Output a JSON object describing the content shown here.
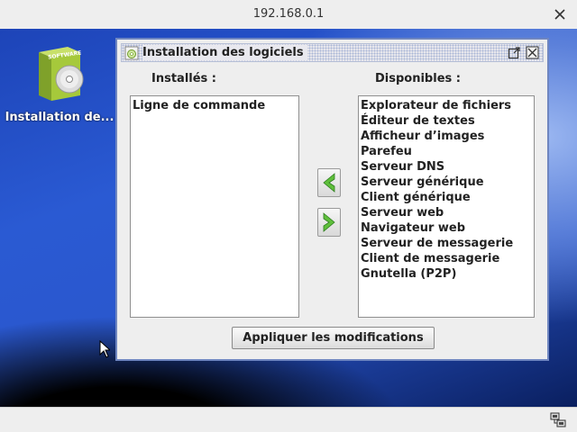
{
  "window": {
    "title": "192.168.0.1"
  },
  "desktop": {
    "icon_label": "Installation de...",
    "icon_badge": "SOFTWARE"
  },
  "app": {
    "title": "Installation des logiciels",
    "installed_header": "Installés :",
    "available_header": "Disponibles :",
    "installed": [
      "Ligne de commande"
    ],
    "available": [
      "Explorateur de fichiers",
      "Éditeur de textes",
      "Afficheur d’images",
      "Parefeu",
      "Serveur DNS",
      "Serveur générique",
      "Client générique",
      "Serveur web",
      "Navigateur web",
      "Serveur de messagerie",
      "Client de messagerie",
      "Gnutella (P2P)"
    ],
    "apply_label": "Appliquer les modifications"
  },
  "icons": {
    "close": "close-icon",
    "maximize": "maximize-icon",
    "add": "arrow-left-icon",
    "remove": "arrow-right-icon",
    "network": "network-icon"
  },
  "colors": {
    "arrow_green": "#4caf50",
    "window_border": "#6f86c0"
  }
}
